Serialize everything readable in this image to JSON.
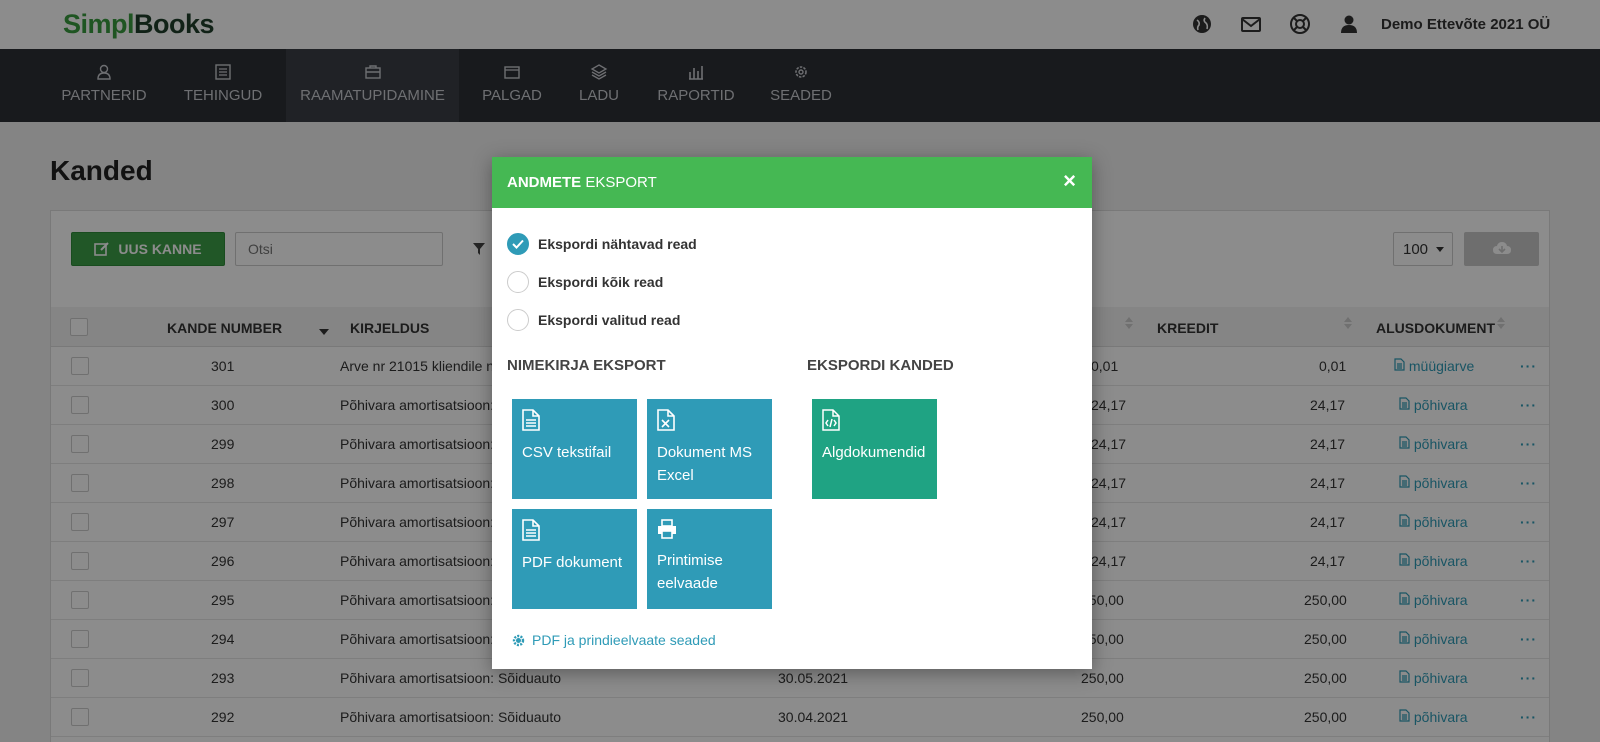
{
  "header": {
    "logo_part1": "Simpl",
    "logo_part2": "Books",
    "company": "Demo Ettevõte 2021 OÜ",
    "icons": [
      "globe-icon",
      "mail-icon",
      "help-icon",
      "user-icon"
    ]
  },
  "nav": {
    "items": [
      {
        "label": "PARTNERID",
        "icon": "partner-icon"
      },
      {
        "label": "TEHINGUD",
        "icon": "list-icon"
      },
      {
        "label": "RAAMATUPIDAMINE",
        "icon": "briefcase-icon",
        "active": true
      },
      {
        "label": "PALGAD",
        "icon": "wallet-icon"
      },
      {
        "label": "LADU",
        "icon": "box-icon"
      },
      {
        "label": "RAPORTID",
        "icon": "chart-icon"
      },
      {
        "label": "SEADED",
        "icon": "gear-icon"
      }
    ]
  },
  "page": {
    "title": "Kanded",
    "new_button": "UUS KANNE",
    "search_placeholder": "Otsi",
    "per_page": "100"
  },
  "table": {
    "headers": {
      "number": "KANDE NUMBER",
      "description": "KIRJELDUS",
      "credit": "KREEDIT",
      "document": "ALUSDOKUMENT"
    },
    "rows": [
      {
        "number": "301",
        "description": "Arve nr 21015 kliendile n",
        "date": "",
        "debit": "0,01",
        "credit": "0,01",
        "doc": "müügiarve"
      },
      {
        "number": "300",
        "description": "Põhivara amortisatsioon:",
        "date": "",
        "debit": "24,17",
        "credit": "24,17",
        "doc": "põhivara"
      },
      {
        "number": "299",
        "description": "Põhivara amortisatsioon:",
        "date": "",
        "debit": "24,17",
        "credit": "24,17",
        "doc": "põhivara"
      },
      {
        "number": "298",
        "description": "Põhivara amortisatsioon:",
        "date": "",
        "debit": "24,17",
        "credit": "24,17",
        "doc": "põhivara"
      },
      {
        "number": "297",
        "description": "Põhivara amortisatsioon:",
        "date": "",
        "debit": "24,17",
        "credit": "24,17",
        "doc": "põhivara"
      },
      {
        "number": "296",
        "description": "Põhivara amortisatsioon:",
        "date": "",
        "debit": "24,17",
        "credit": "24,17",
        "doc": "põhivara"
      },
      {
        "number": "295",
        "description": "Põhivara amortisatsioon:",
        "date": "",
        "debit": "250,00",
        "credit": "250,00",
        "doc": "põhivara"
      },
      {
        "number": "294",
        "description": "Põhivara amortisatsioon:",
        "date": "",
        "debit": "250,00",
        "credit": "250,00",
        "doc": "põhivara"
      },
      {
        "number": "293",
        "description": "Põhivara amortisatsioon: Sõiduauto",
        "date": "30.05.2021",
        "debit": "250,00",
        "credit": "250,00",
        "doc": "põhivara"
      },
      {
        "number": "292",
        "description": "Põhivara amortisatsioon: Sõiduauto",
        "date": "30.04.2021",
        "debit": "250,00",
        "credit": "250,00",
        "doc": "põhivara"
      }
    ]
  },
  "modal": {
    "title_bold": "ANDMETE",
    "title_rest": "EKSPORT",
    "close": "×",
    "options": [
      {
        "label": "Ekspordi nähtavad read",
        "checked": true
      },
      {
        "label": "Ekspordi kõik read",
        "checked": false
      },
      {
        "label": "Ekspordi valitud read",
        "checked": false
      }
    ],
    "section_list": "NIMEKIRJA EKSPORT",
    "section_entries": "EKSPORDI KANDED",
    "tiles": {
      "csv": "CSV tekstifail",
      "excel": "Dokument MS Excel",
      "pdf": "PDF dokument",
      "print": "Printimise eelvaade",
      "source": "Algdokumendid"
    },
    "settings_link": "PDF ja prindieelvaate seaded"
  },
  "colors": {
    "accent_green": "#45b853",
    "accent_blue": "#2f9bb7",
    "tile_green": "#1fa383",
    "nav_bg": "#2d3036"
  }
}
